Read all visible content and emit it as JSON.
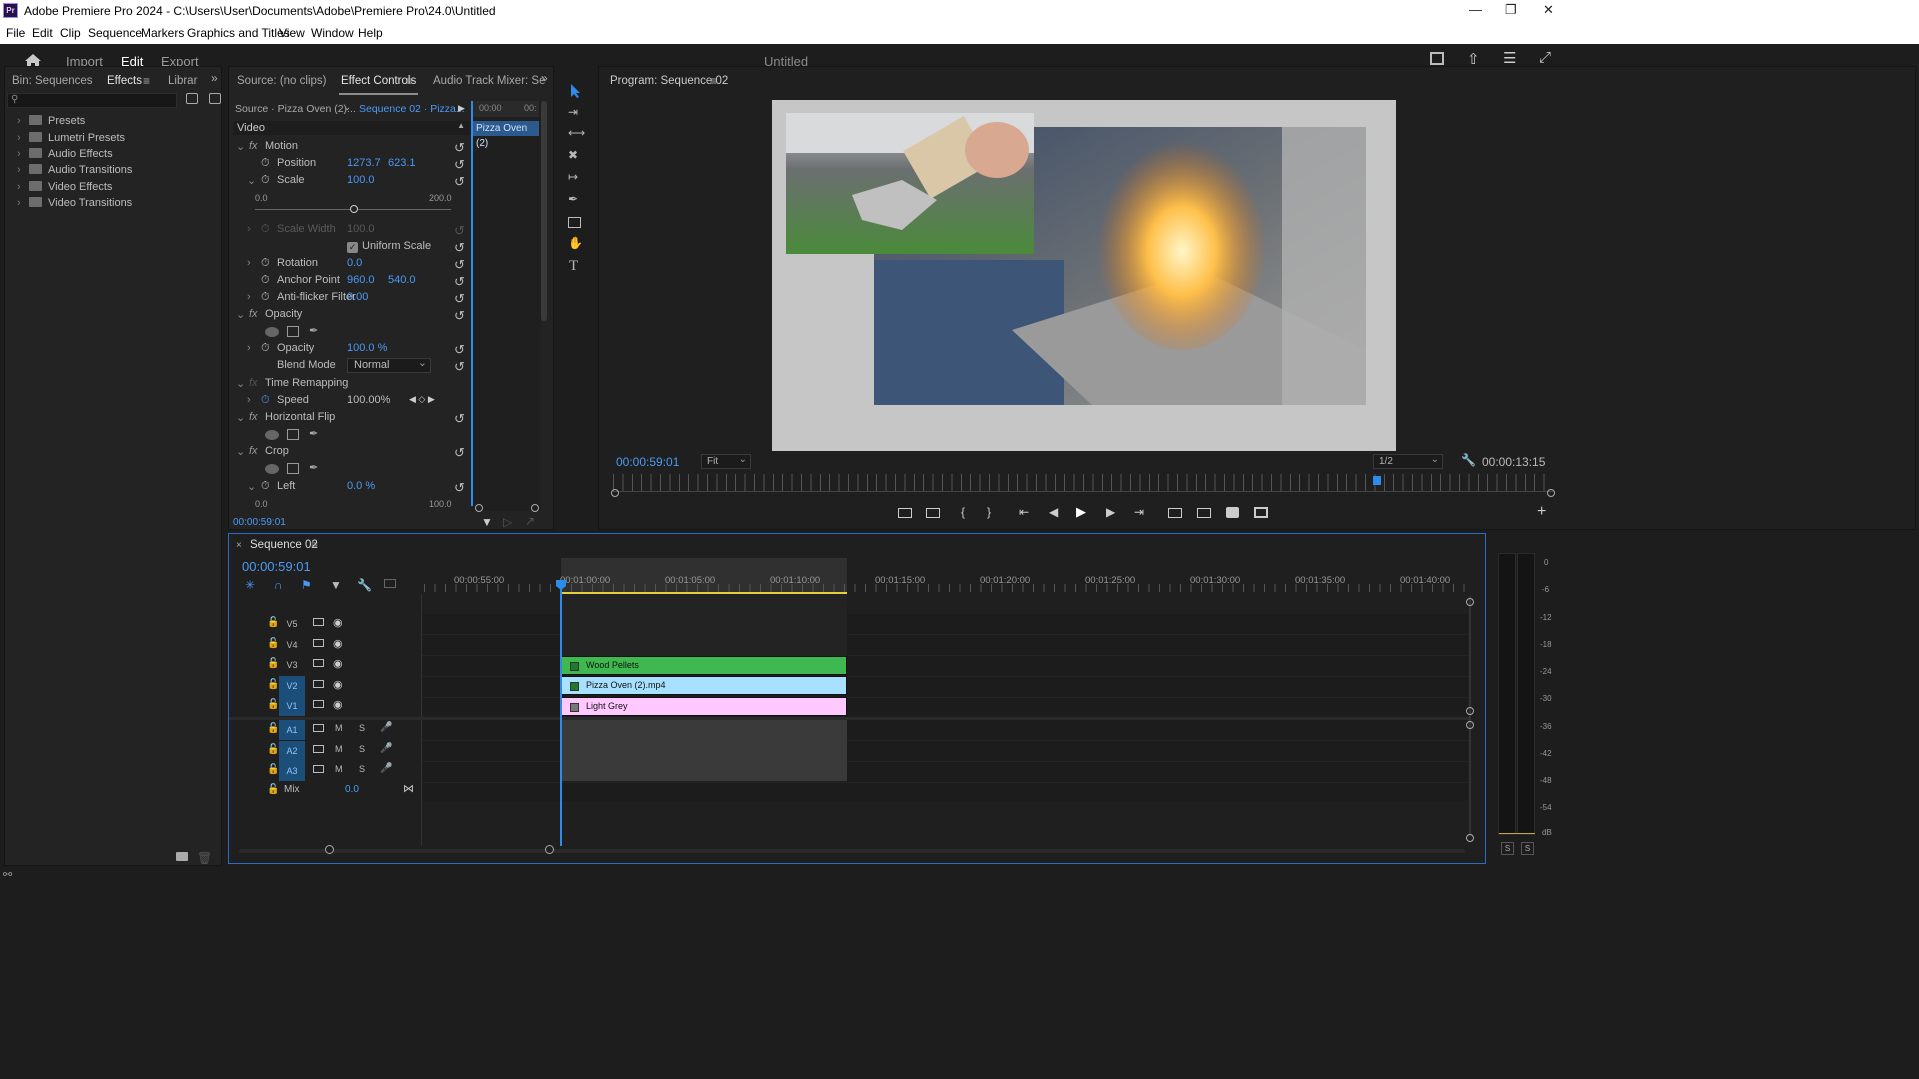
{
  "window": {
    "title": "Adobe Premiere Pro 2024 - C:\\Users\\User\\Documents\\Adobe\\Premiere Pro\\24.0\\Untitled",
    "app_badge": "Pr"
  },
  "menu": [
    "File",
    "Edit",
    "Clip",
    "Sequence",
    "Markers",
    "Graphics and Titles",
    "View",
    "Window",
    "Help"
  ],
  "header": {
    "workspaces": [
      "Import",
      "Edit",
      "Export"
    ],
    "active": "Edit",
    "project": "Untitled"
  },
  "left_panel": {
    "tabs": [
      "Bin: Sequences",
      "Effects",
      "Librar"
    ],
    "active": "Effects",
    "tree": [
      "Presets",
      "Lumetri Presets",
      "Audio Effects",
      "Audio Transitions",
      "Video Effects",
      "Video Transitions"
    ]
  },
  "effect_panel": {
    "tabs": [
      "Source: (no clips)",
      "Effect Controls",
      "Audio Track Mixer: Se"
    ],
    "active": "Effect Controls",
    "source": "Source · Pizza Oven (2)...",
    "sequence": "Sequence 02 · Pizza...",
    "section": "Video",
    "clip_label": "Pizza Oven (2)",
    "mini_time_start": "00:00",
    "mini_time_end": "00:",
    "motion": "Motion",
    "position_label": "Position",
    "position_x": "1273.7",
    "position_y": "623.1",
    "scale_label": "Scale",
    "scale_value": "100.0",
    "scale_min": "0.0",
    "scale_max": "200.0",
    "scale_width_label": "Scale Width",
    "scale_width_value": "100.0",
    "uniform_scale": "Uniform Scale",
    "rotation_label": "Rotation",
    "rotation_value": "0.0",
    "anchor_label": "Anchor Point",
    "anchor_x": "960.0",
    "anchor_y": "540.0",
    "flicker_label": "Anti-flicker Filter",
    "flicker_value": "0.00",
    "opacity_section": "Opacity",
    "opacity_label": "Opacity",
    "opacity_value": "100.0 %",
    "blend_label": "Blend Mode",
    "blend_value": "Normal",
    "time_remap": "Time Remapping",
    "speed_label": "Speed",
    "speed_value": "100.00%",
    "hflip": "Horizontal Flip",
    "crop": "Crop",
    "left_label": "Left",
    "left_value": "0.0 %",
    "crop_min": "0.0",
    "crop_max": "100.0",
    "timecode": "00:00:59:01"
  },
  "program": {
    "tab": "Program: Sequence 02",
    "timecode": "00:00:59:01",
    "fit": "Fit",
    "resolution": "1/2",
    "duration": "00:00:13:15"
  },
  "timeline": {
    "tab": "Sequence 02",
    "timecode": "00:00:59:01",
    "ruler": [
      "00:00:55:00",
      "00:01:00:00",
      "00:01:05:00",
      "00:01:10:00",
      "00:01:15:00",
      "00:01:20:00",
      "00:01:25:00",
      "00:01:30:00",
      "00:01:35:00",
      "00:01:40:00"
    ],
    "video_tracks": [
      "V5",
      "V4",
      "V3",
      "V2",
      "V1"
    ],
    "audio_tracks": [
      "A1",
      "A2",
      "A3"
    ],
    "mute": "M",
    "solo": "S",
    "mix_label": "Mix",
    "mix_value": "0.0",
    "clips": [
      {
        "name": "Wood Pellets",
        "color": "#3fb84f"
      },
      {
        "name": "Pizza Oven (2).mp4",
        "color": "#a8e0ff"
      },
      {
        "name": "Light Grey",
        "color": "#ffc8ff"
      }
    ]
  },
  "meter": {
    "labels": [
      "0",
      "-6",
      "-12",
      "-18",
      "-24",
      "-30",
      "-36",
      "-42",
      "-48",
      "-54",
      "dB"
    ],
    "solo_left": "S",
    "solo_right": "S"
  },
  "colors": {
    "accent": "#2d8ceb",
    "timecode": "#4a9af5",
    "panel": "#232323"
  }
}
